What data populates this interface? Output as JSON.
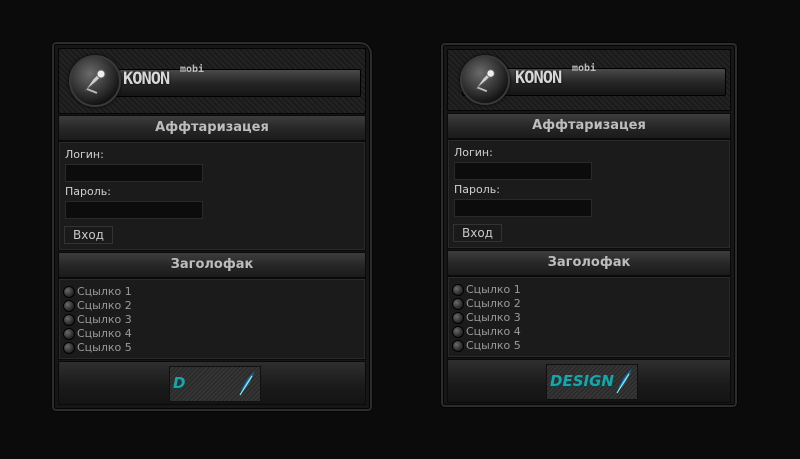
{
  "brand": {
    "name": "KONON",
    "suffix": "mobi"
  },
  "accent_color": "#1fa3a8",
  "panels": [
    {
      "auth_title": "Аффтаризацея",
      "login_label": "Логин:",
      "login_value": "",
      "password_label": "Пароль:",
      "password_value": "",
      "submit_label": "Вход",
      "links_title": "Заголофак",
      "links": [
        "Сцылко 1",
        "Сцылко 2",
        "Сцылко 3",
        "Сцылко 4",
        "Сцылко 5"
      ],
      "banner_text": "D"
    },
    {
      "auth_title": "Аффтаризацея",
      "login_label": "Логин:",
      "login_value": "",
      "password_label": "Пароль:",
      "password_value": "",
      "submit_label": "Вход",
      "links_title": "Заголофак",
      "links": [
        "Сцылко 1",
        "Сцылко 2",
        "Сцылко 3",
        "Сцылко 4",
        "Сцылко 5"
      ],
      "banner_text": "DESIGN"
    }
  ],
  "icons": {
    "logo": "gramophone-icon",
    "bullet": "radio-bullet-icon",
    "banner": "feather-icon"
  }
}
